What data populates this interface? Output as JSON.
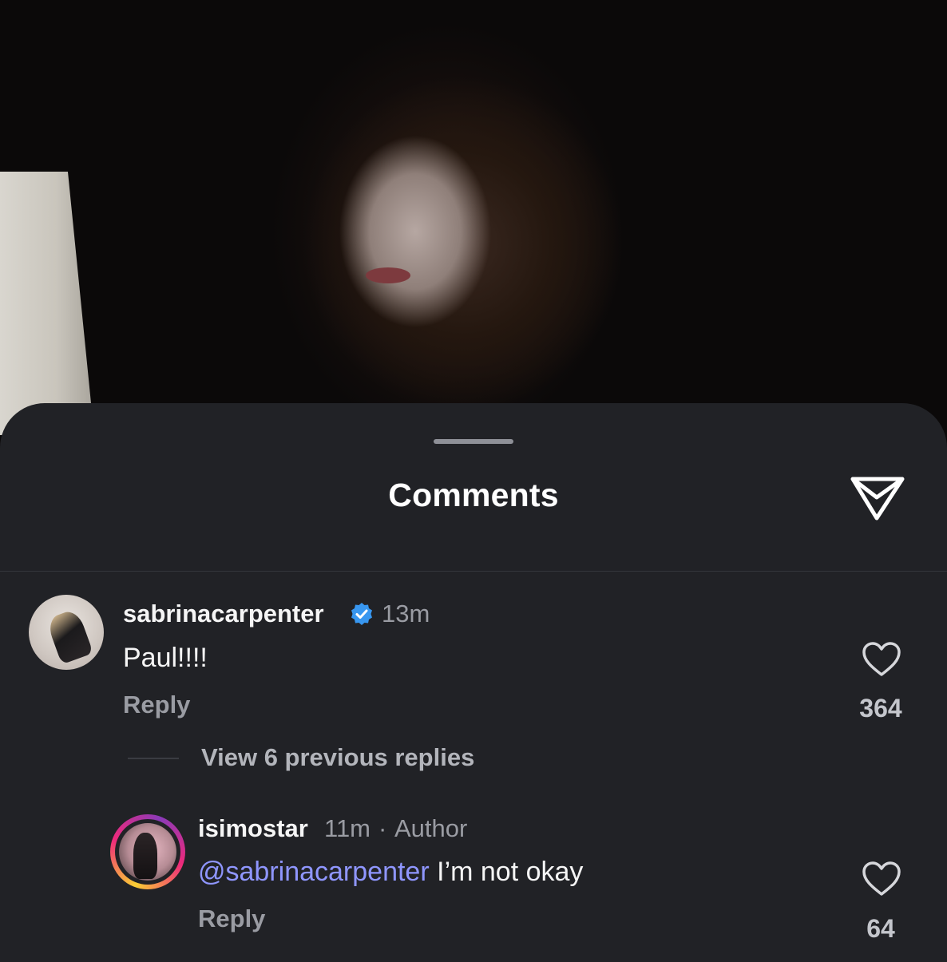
{
  "sheet": {
    "title": "Comments",
    "share_icon": "paper-plane-icon"
  },
  "comments": [
    {
      "username": "sabrinacarpenter",
      "verified": true,
      "time": "13m",
      "text": "Paul!!!!",
      "reply_label": "Reply",
      "likes": "364"
    }
  ],
  "thread": {
    "view_replies_label": "View 6 previous replies"
  },
  "replies": [
    {
      "username": "isimostar",
      "time": "11m",
      "separator": "·",
      "badge": "Author",
      "mention": "@sabrinacarpenter",
      "text": " I’m not okay",
      "reply_label": "Reply",
      "likes": "64",
      "has_story_ring": true
    }
  ],
  "colors": {
    "sheet_bg": "#212226",
    "mention": "#8f96ff",
    "verified": "#3897f0"
  }
}
